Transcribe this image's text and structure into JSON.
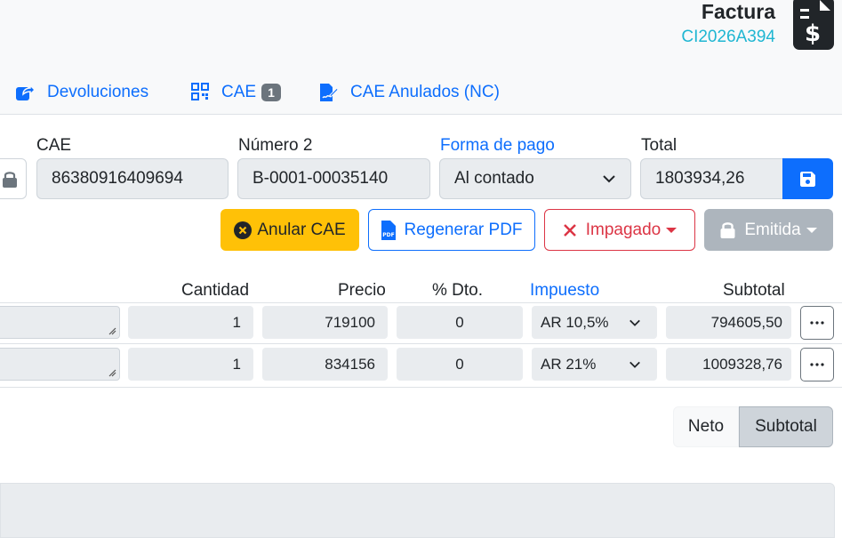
{
  "document": {
    "title": "Factura",
    "number": "CI2026A394",
    "icon": "file-invoice-dollar-icon"
  },
  "tabs": [
    {
      "label": "Devoluciones",
      "icon": "share-square-icon"
    },
    {
      "label": "CAE",
      "icon": "qrcode-icon",
      "badge": "1"
    },
    {
      "label": "CAE Anulados (NC)",
      "icon": "file-signature-icon"
    }
  ],
  "form": {
    "cae": {
      "label": "CAE",
      "value": "86380916409694"
    },
    "numero": {
      "label": "Número 2",
      "value": "B-0001-00035140"
    },
    "forma_pago": {
      "label": "Forma de pago",
      "value": "Al contado"
    },
    "total": {
      "label": "Total",
      "value": "1803934,26"
    }
  },
  "actions": {
    "anular": "Anular CAE",
    "regenerar": "Regenerar PDF",
    "impagado": "Impagado",
    "emitida": "Emitida"
  },
  "table": {
    "headers": {
      "cantidad": "Cantidad",
      "precio": "Precio",
      "dto": "% Dto.",
      "impuesto": "Impuesto",
      "subtotal": "Subtotal"
    },
    "rows": [
      {
        "cantidad": "1",
        "precio": "719100",
        "dto": "0",
        "impuesto": "AR 10,5%",
        "subtotal": "794605,50"
      },
      {
        "cantidad": "1",
        "precio": "834156",
        "dto": "0",
        "impuesto": "AR 21%",
        "subtotal": "1009328,76"
      }
    ]
  },
  "totals_toggle": {
    "neto": "Neto",
    "subtotal": "Subtotal",
    "active": "subtotal"
  },
  "colors": {
    "primary": "#0d6efd",
    "warning": "#ffc107",
    "danger": "#dc3545",
    "secondary": "#adb5bd",
    "info": "#1fb6d2"
  }
}
